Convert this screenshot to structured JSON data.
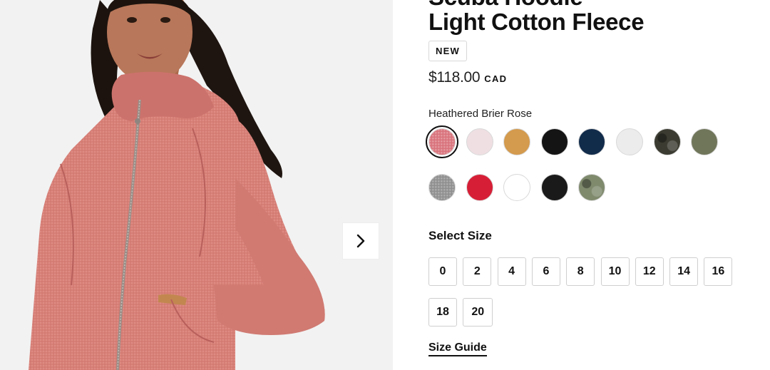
{
  "product": {
    "title_line1": "Scuba Hoodie",
    "title_line2": "Light Cotton Fleece",
    "badge": "NEW",
    "price": "$118.00",
    "currency": "CAD",
    "selected_color_name": "Heathered Brier Rose"
  },
  "swatches": [
    {
      "name": "heathered-brier-rose",
      "color": "#d9737c",
      "pattern": "heather"
    },
    {
      "name": "light-pink",
      "color": "#efdfe3"
    },
    {
      "name": "amber",
      "color": "#d49a4d"
    },
    {
      "name": "black",
      "color": "#141414"
    },
    {
      "name": "navy",
      "color": "#112b4b"
    },
    {
      "name": "light-grey",
      "color": "#ececec"
    },
    {
      "name": "dark-camo",
      "color": "#3b3b31",
      "pattern": "camo"
    },
    {
      "name": "olive",
      "color": "#70765a"
    },
    {
      "name": "heathered-grey",
      "color": "#8f8f8f",
      "pattern": "heather"
    },
    {
      "name": "red",
      "color": "#d61f37"
    },
    {
      "name": "white",
      "color": "#ffffff"
    },
    {
      "name": "black-2",
      "color": "#1a1a1a"
    },
    {
      "name": "green-camo",
      "color": "#7f8a6d",
      "pattern": "camo"
    }
  ],
  "sizes": {
    "label": "Select Size",
    "options": [
      "0",
      "2",
      "4",
      "6",
      "8",
      "10",
      "12",
      "14",
      "16",
      "18",
      "20"
    ],
    "guide_label": "Size Guide"
  },
  "gallery": {
    "next_icon": "chevron-right-icon"
  }
}
